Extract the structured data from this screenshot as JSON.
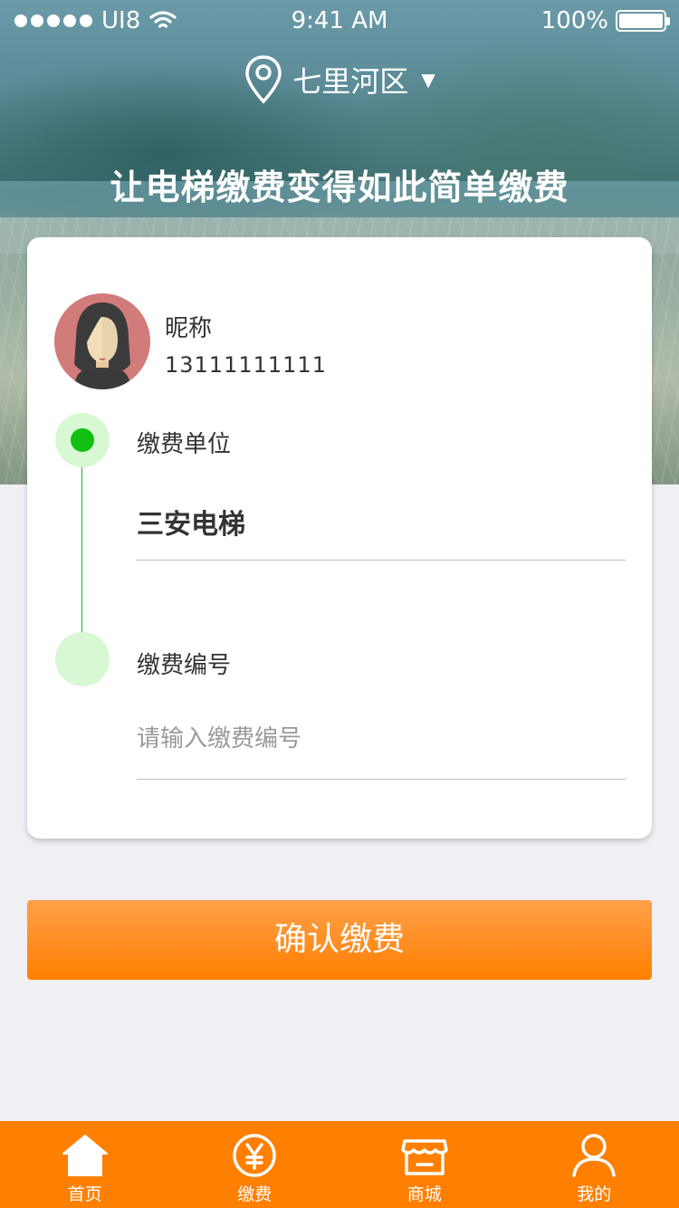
{
  "status_bar": {
    "carrier": "UI8",
    "time": "9:41 AM",
    "battery": "100%",
    "icons": [
      "signal-dots-icon",
      "wifi-icon",
      "battery-icon"
    ]
  },
  "location": {
    "district": "七里河区",
    "icon": "location-pin-icon",
    "caret": "▼"
  },
  "headline": "让电梯缴费变得如此简单缴费",
  "user": {
    "nickname": "昵称",
    "phone": "13111111111"
  },
  "form": {
    "unit_label": "缴费单位",
    "unit_value": "三安电梯",
    "number_label": "缴费编号",
    "number_placeholder": "请输入缴费编号",
    "number_value": ""
  },
  "confirm_button": "确认缴费",
  "tabbar": {
    "items": [
      {
        "label": "首页",
        "icon": "home-icon"
      },
      {
        "label": "缴费",
        "icon": "yen-coin-icon"
      },
      {
        "label": "商城",
        "icon": "store-icon"
      },
      {
        "label": "我的",
        "icon": "user-icon"
      }
    ]
  },
  "colors": {
    "accent": "#ff7f00",
    "timeline_green": "#11c011",
    "timeline_light": "#d8f8d4",
    "avatar_bg": "#d27b7b"
  }
}
